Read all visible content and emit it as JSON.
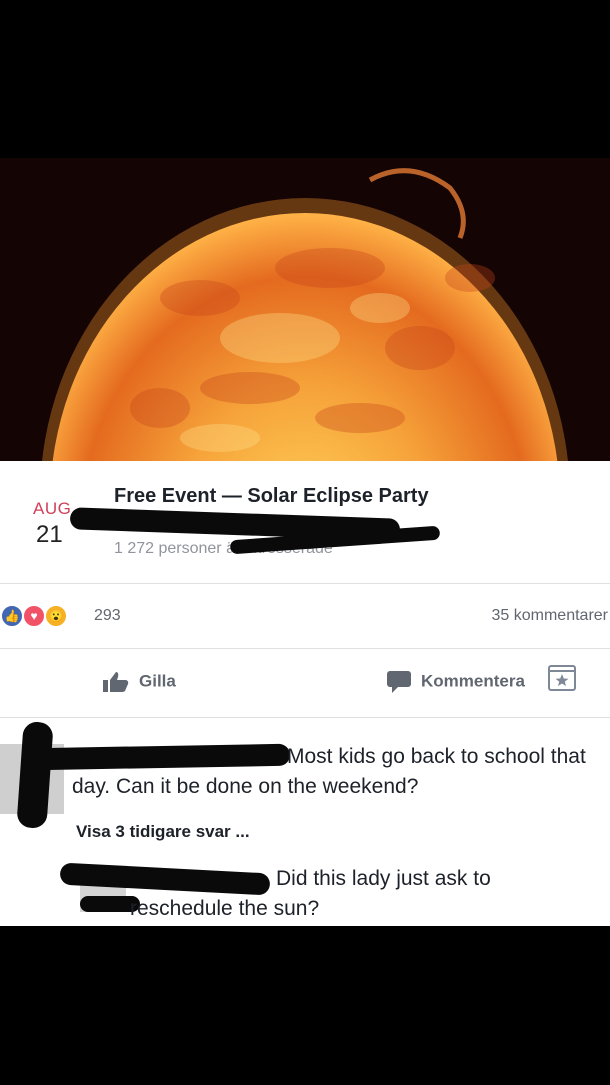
{
  "event": {
    "month": "AUG.",
    "day": "21",
    "title": "Free Event — Solar Eclipse Party",
    "interested": "1 272 personer är intresserade",
    "calendar_icon": "star-calendar-icon"
  },
  "stats": {
    "reactions": [
      "like-reaction-icon",
      "love-reaction-icon",
      "wow-reaction-icon"
    ],
    "reaction_count": "293",
    "comment_count": "35 kommentarer"
  },
  "actions": {
    "like_label": "Gilla",
    "comment_label": "Kommentera"
  },
  "comments": {
    "first_text": "Most kids go back to school that day. Can it be done on the weekend?",
    "more_replies": "Visa 3 tidigare svar ...",
    "reply_line1": "Did this lady just ask to",
    "reply_line2": "reschedule the sun?"
  },
  "colors": {
    "sun_core": "#f5a623",
    "sun_edge": "#e0561b",
    "facebook_blue": "#4267b2",
    "love_red": "#f25268",
    "wow_yellow": "#f7b125"
  }
}
